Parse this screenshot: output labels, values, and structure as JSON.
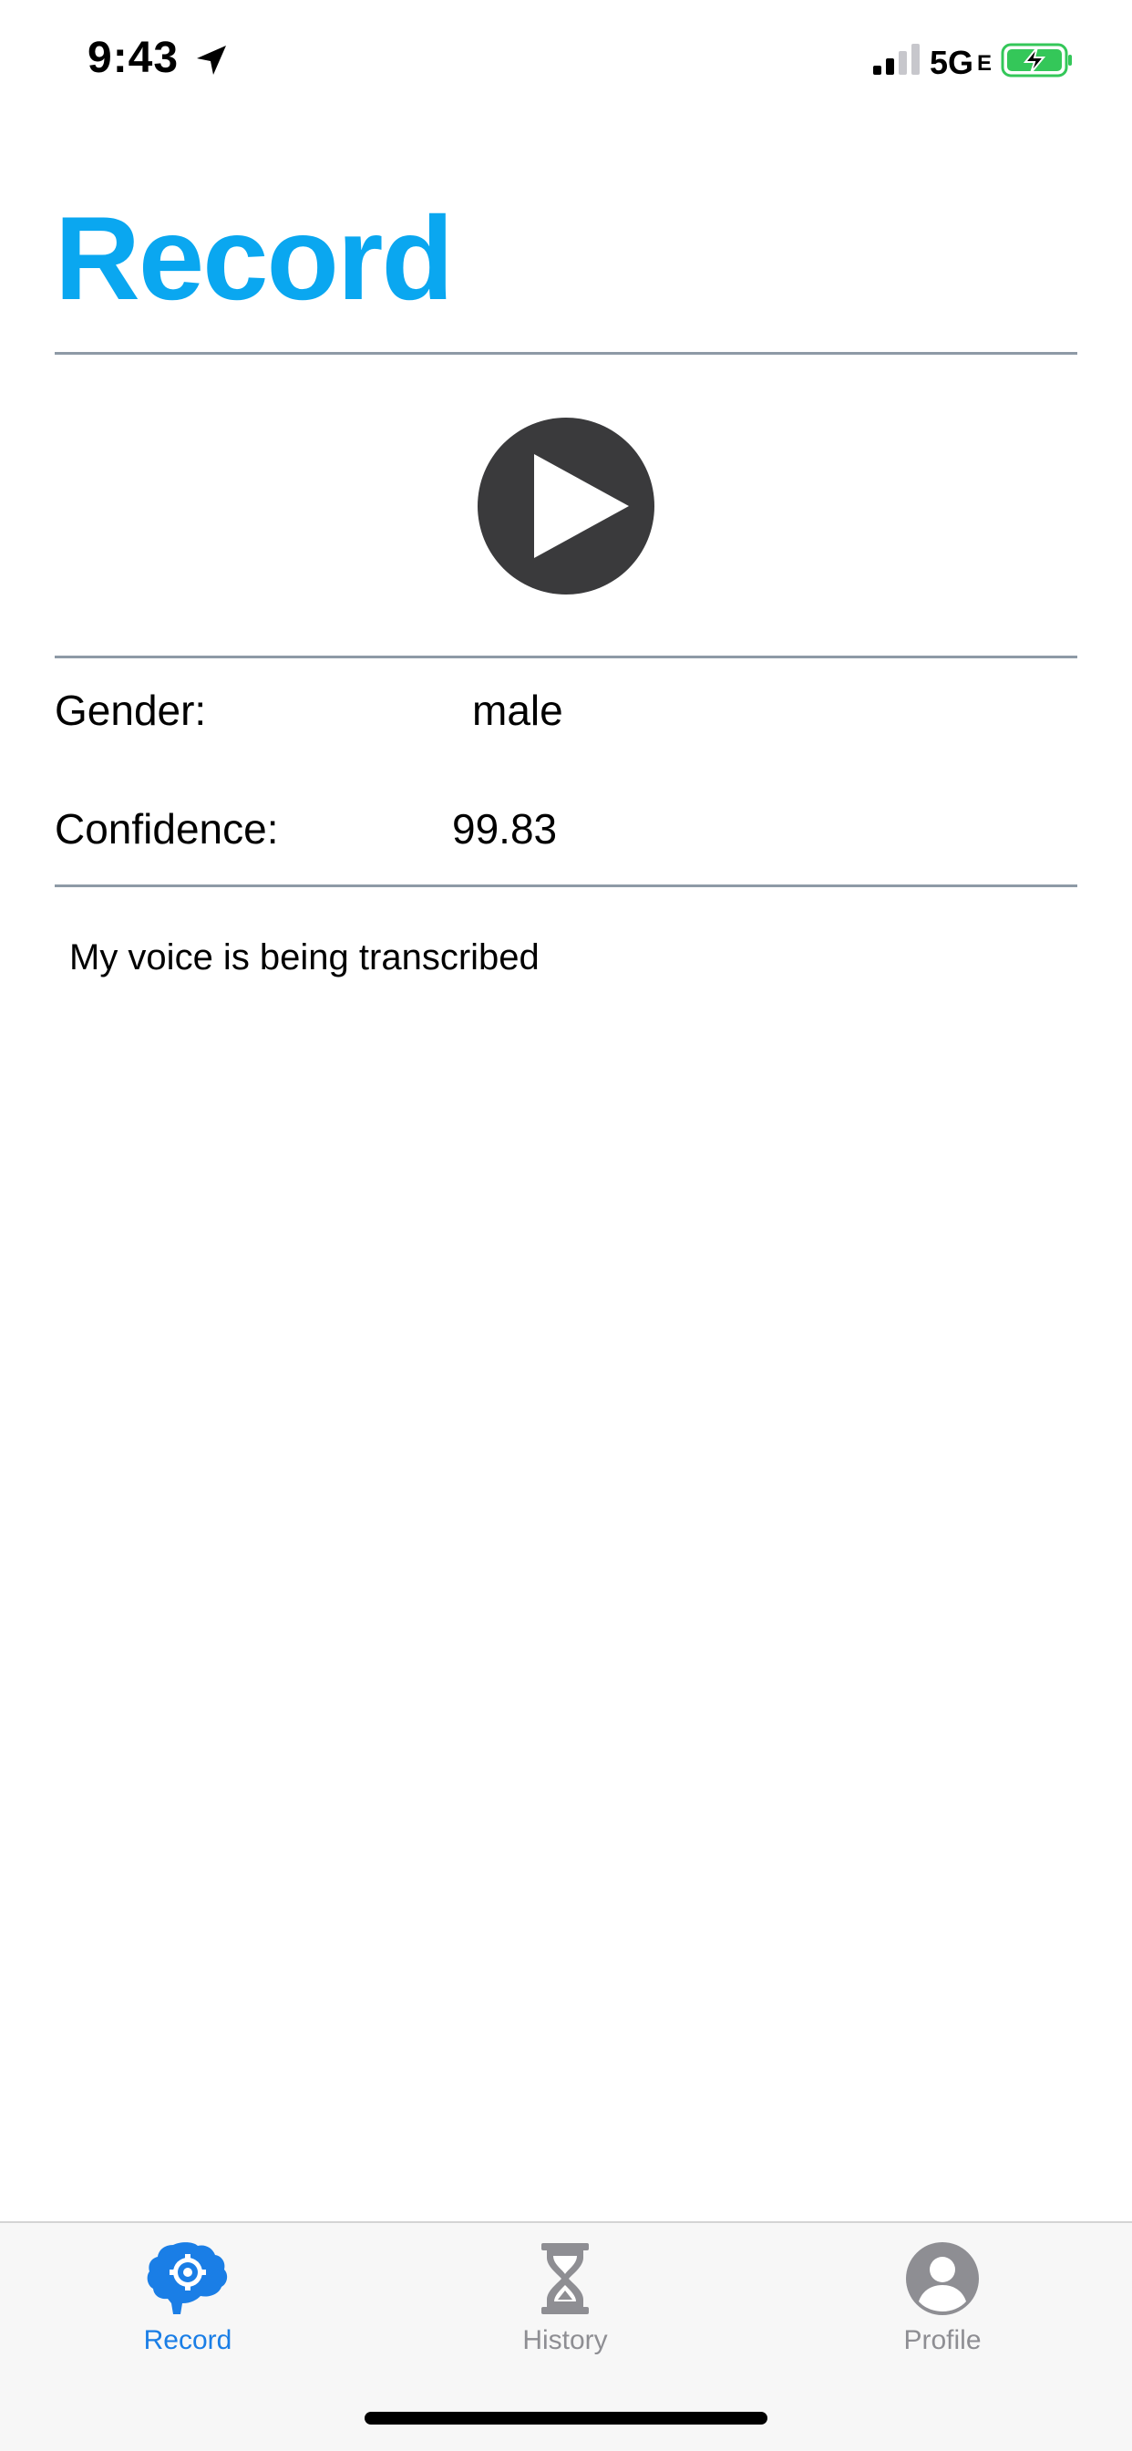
{
  "status_bar": {
    "time": "9:43",
    "network": "5G",
    "network_suffix": "E",
    "icons": [
      "location-arrow-icon",
      "cellular-signal-icon",
      "battery-charging-icon"
    ]
  },
  "page": {
    "title": "Record"
  },
  "player": {
    "button_icon": "play-icon"
  },
  "results": {
    "gender_label": "Gender:",
    "gender_value": "male",
    "confidence_label": "Confidence:",
    "confidence_value": "99.83"
  },
  "transcript": {
    "text": "My voice is being transcribed"
  },
  "tab_bar": {
    "items": [
      {
        "label": "Record",
        "icon": "brain-gear-icon",
        "active": true
      },
      {
        "label": "History",
        "icon": "hourglass-icon",
        "active": false
      },
      {
        "label": "Profile",
        "icon": "user-circle-icon",
        "active": false
      }
    ]
  },
  "colors": {
    "accent": "#0aa7f0",
    "active_tab": "#1a7ee6",
    "inactive_tab": "#8e8e93",
    "play_button": "#3a3a3c",
    "divider": "#8e9aa6",
    "battery": "#34c759"
  }
}
